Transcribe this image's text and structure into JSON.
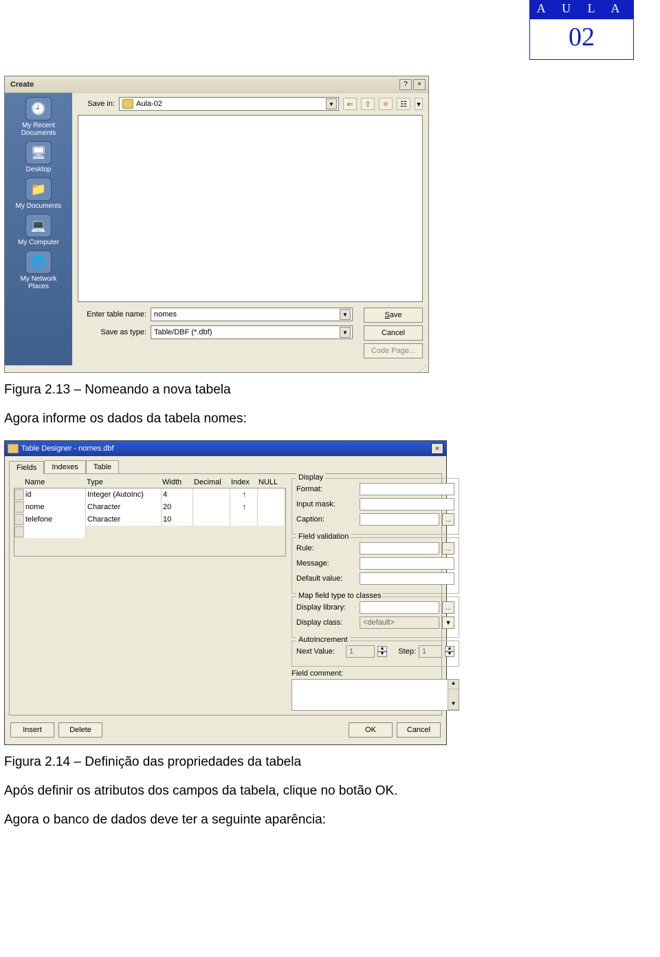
{
  "header": {
    "aula_label": "A  U  L  A",
    "aula_num": "02"
  },
  "figs": {
    "f213": "Figura 2.13 – Nomeando a nova tabela",
    "p1": "Agora informe os dados da tabela nomes:",
    "f214": "Figura 2.14 – Definição das propriedades da tabela",
    "p2": "Após definir os atributos dos campos da tabela, clique no botão OK.",
    "p3": "Agora o banco de dados deve ter a seguinte aparência:"
  },
  "create": {
    "title": "Create",
    "help_btn": "?",
    "close_btn": "×",
    "save_in_label": "Save in:",
    "folder_value": "Aula-02",
    "places": [
      {
        "icon": "🕘",
        "label": "My Recent Documents"
      },
      {
        "icon": "🖥",
        "label": "Desktop"
      },
      {
        "icon": "📁",
        "label": "My Documents"
      },
      {
        "icon": "💻",
        "label": "My Computer"
      },
      {
        "icon": "🌐",
        "label": "My Network Places"
      }
    ],
    "nav": {
      "back": "⇐",
      "up": "⇧",
      "new": "✳",
      "views": "☷",
      "views_arrow": "▾"
    },
    "table_name_label": "Enter table name:",
    "table_name_value": "nomes",
    "save_type_label": "Save as type:",
    "save_type_value": "Table/DBF (*.dbf)",
    "save_btn": "Save",
    "cancel_btn": "Cancel",
    "codepage_btn": "Code Page..."
  },
  "designer": {
    "title": "Table Designer - nomes.dbf",
    "close_btn": "×",
    "tabs": {
      "fields": "Fields",
      "indexes": "Indexes",
      "table": "Table"
    },
    "columns": {
      "name": "Name",
      "type": "Type",
      "width": "Width",
      "decimal": "Decimal",
      "index": "Index",
      "null": "NULL"
    },
    "rows": [
      {
        "name": "id",
        "type": "Integer (AutoInc)",
        "width": "4",
        "decimal": "",
        "index": "↑",
        "null": ""
      },
      {
        "name": "nome",
        "type": "Character",
        "width": "20",
        "decimal": "",
        "index": "↑",
        "null": ""
      },
      {
        "name": "telefone",
        "type": "Character",
        "width": "10",
        "decimal": "",
        "index": "",
        "null": ""
      }
    ],
    "display": {
      "legend": "Display",
      "format": "Format:",
      "input_mask": "Input mask:",
      "caption": "Caption:"
    },
    "validation": {
      "legend": "Field validation",
      "rule": "Rule:",
      "message": "Message:",
      "default": "Default value:"
    },
    "map": {
      "legend": "Map field type to classes",
      "library": "Display library:",
      "class": "Display class:",
      "class_value": "<default>"
    },
    "autoinc": {
      "legend": "AutoIncrement",
      "next": "Next Value:",
      "next_value": "1",
      "step": "Step:",
      "step_value": "1"
    },
    "comment_label": "Field comment:",
    "footer": {
      "insert": "Insert",
      "delete": "Delete",
      "ok": "OK",
      "cancel": "Cancel"
    }
  }
}
